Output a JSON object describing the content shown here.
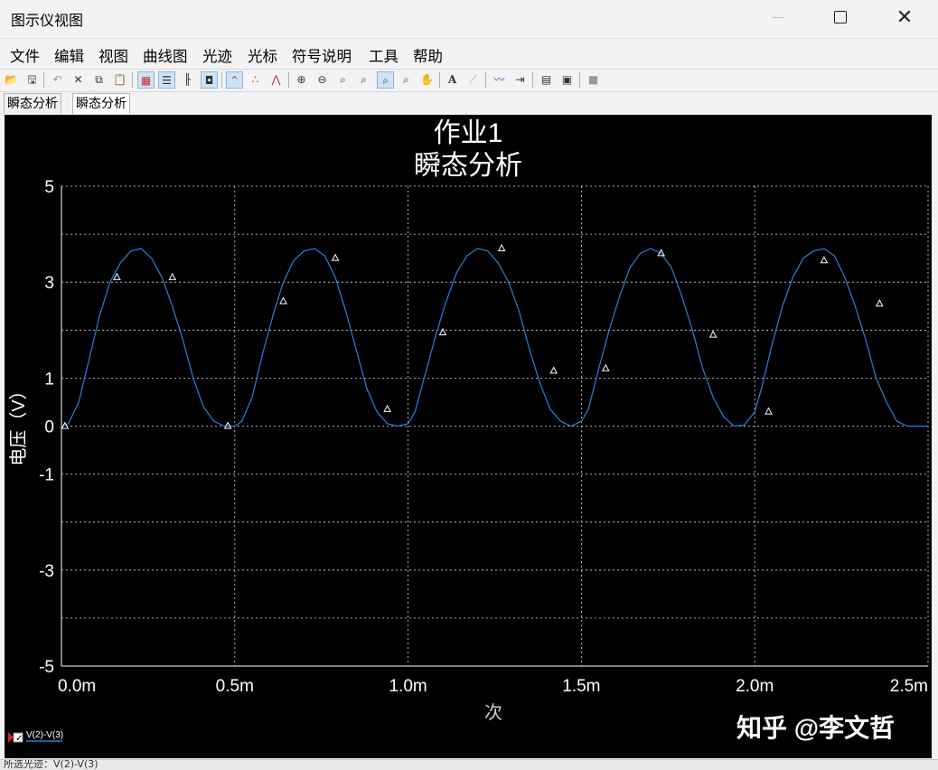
{
  "window": {
    "title": "图示仪视图",
    "minimize_icon": "minimize-icon",
    "maximize_icon": "maximize-icon",
    "close_icon": "close-icon"
  },
  "menu": [
    "文件",
    "编辑",
    "视图",
    "曲线图",
    "光迹",
    "光标",
    "符号说明",
    "工具",
    "帮助"
  ],
  "toolbar": {
    "icons": [
      "open-icon",
      "save-icon",
      "undo-icon",
      "delete-icon",
      "copy-icon",
      "paste-icon",
      "grid-icon",
      "legend-icon",
      "toggle-axes-icon",
      "overlay-icon",
      "line-trace-icon",
      "scatter-icon",
      "line-marker-icon",
      "zoom-in-icon",
      "zoom-out-icon",
      "zoom-fit-icon",
      "zoom-x-icon",
      "zoom-y-icon",
      "zoom-area-icon",
      "pan-icon",
      "text-label-icon",
      "annotate-icon",
      "trace-properties-icon",
      "export-icon",
      "copy-graph-icon",
      "paste-graph-icon",
      "stop-icon"
    ]
  },
  "tabs": [
    "瞬态分析",
    "瞬态分析"
  ],
  "chart_data": {
    "type": "line",
    "title": "作业1",
    "subtitle": "瞬态分析",
    "ylabel": "电压（V）",
    "xlabel": "次",
    "x_tick_labels": [
      "0.0m",
      "0.5m",
      "1.0m",
      "1.5m",
      "2.0m",
      "2.5m"
    ],
    "x_ticks": [
      0,
      0.5,
      1.0,
      1.5,
      2.0,
      2.5
    ],
    "xlim": [
      0,
      2.5
    ],
    "y_tick_labels": [
      "5",
      "3",
      "1",
      "0",
      "-1",
      "-3",
      "-5"
    ],
    "y_ticks": [
      5,
      3,
      1,
      0,
      -1,
      -3,
      -5
    ],
    "ylim": [
      -5,
      5
    ],
    "grid": true,
    "colors": {
      "background": "#000000",
      "trace": "#2f7fd6",
      "grid": "#d8d8d8",
      "text": "#ffffff"
    },
    "series": [
      {
        "name": "V(2)-V(3)",
        "x": [
          0,
          0.02,
          0.05,
          0.08,
          0.11,
          0.14,
          0.17,
          0.2,
          0.23,
          0.26,
          0.29,
          0.32,
          0.35,
          0.38,
          0.41,
          0.44,
          0.47,
          0.5,
          0.52,
          0.55,
          0.58,
          0.61,
          0.64,
          0.67,
          0.7,
          0.73,
          0.76,
          0.79,
          0.82,
          0.85,
          0.88,
          0.91,
          0.94,
          0.97,
          1.0,
          1.02,
          1.05,
          1.08,
          1.11,
          1.14,
          1.17,
          1.2,
          1.23,
          1.26,
          1.29,
          1.32,
          1.35,
          1.38,
          1.41,
          1.44,
          1.47,
          1.5,
          1.52,
          1.55,
          1.58,
          1.61,
          1.64,
          1.67,
          1.7,
          1.73,
          1.76,
          1.79,
          1.82,
          1.85,
          1.88,
          1.91,
          1.94,
          1.97,
          2.0,
          2.02,
          2.05,
          2.08,
          2.11,
          2.14,
          2.17,
          2.2,
          2.23,
          2.26,
          2.29,
          2.32,
          2.35,
          2.38,
          2.41,
          2.44,
          2.47,
          2.5
        ],
        "y": [
          0.0,
          0.05,
          0.5,
          1.4,
          2.3,
          3.0,
          3.4,
          3.65,
          3.7,
          3.5,
          3.1,
          2.5,
          1.8,
          1.0,
          0.4,
          0.1,
          0.0,
          0.0,
          0.1,
          0.6,
          1.5,
          2.3,
          3.0,
          3.45,
          3.65,
          3.7,
          3.55,
          3.1,
          2.4,
          1.6,
          0.8,
          0.3,
          0.05,
          0.0,
          0.05,
          0.3,
          1.1,
          1.9,
          2.6,
          3.2,
          3.55,
          3.7,
          3.65,
          3.4,
          3.0,
          2.4,
          1.6,
          0.9,
          0.35,
          0.1,
          0.0,
          0.1,
          0.35,
          1.2,
          2.0,
          2.7,
          3.3,
          3.6,
          3.7,
          3.6,
          3.3,
          2.7,
          2.0,
          1.2,
          0.6,
          0.2,
          0.0,
          0.02,
          0.3,
          0.8,
          1.7,
          2.5,
          3.1,
          3.5,
          3.65,
          3.7,
          3.55,
          3.1,
          2.5,
          1.8,
          1.0,
          0.5,
          0.1,
          0.0,
          0.0,
          0.0
        ],
        "marker_points": [
          {
            "x": 0.01,
            "y": 0.0
          },
          {
            "x": 0.16,
            "y": 3.1
          },
          {
            "x": 0.32,
            "y": 3.1
          },
          {
            "x": 0.48,
            "y": 0.0
          },
          {
            "x": 0.64,
            "y": 2.6
          },
          {
            "x": 0.79,
            "y": 3.5
          },
          {
            "x": 0.94,
            "y": 0.35
          },
          {
            "x": 1.1,
            "y": 1.95
          },
          {
            "x": 1.27,
            "y": 3.7
          },
          {
            "x": 1.42,
            "y": 1.15
          },
          {
            "x": 1.57,
            "y": 1.2
          },
          {
            "x": 1.73,
            "y": 3.6
          },
          {
            "x": 1.88,
            "y": 1.9
          },
          {
            "x": 2.04,
            "y": 0.3
          },
          {
            "x": 2.2,
            "y": 3.45
          },
          {
            "x": 2.36,
            "y": 2.55
          }
        ]
      }
    ],
    "legend": {
      "placement": "bottom-left",
      "checked": true,
      "label": "V(2)-V(3)"
    },
    "watermark": "知乎 @李文哲"
  },
  "status": {
    "text": "所选光迹：V(2)-V(3)"
  }
}
